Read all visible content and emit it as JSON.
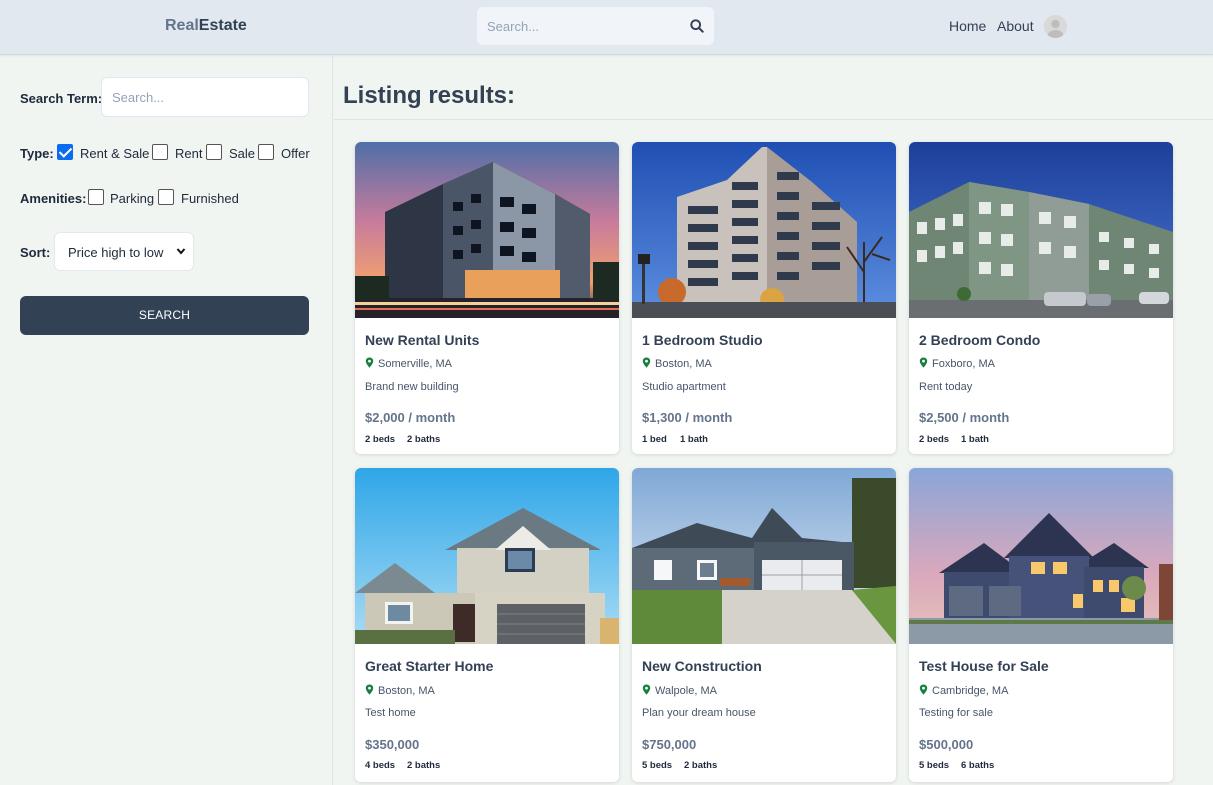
{
  "header": {
    "logo_part1": "Real",
    "logo_part2": "Estate",
    "search_placeholder": "Search...",
    "nav": {
      "home": "Home",
      "about": "About"
    }
  },
  "sidebar": {
    "search_term_label": "Search Term:",
    "search_placeholder": "Search...",
    "type_label": "Type:",
    "types": [
      {
        "label": "Rent & Sale",
        "checked": true
      },
      {
        "label": "Rent",
        "checked": false
      },
      {
        "label": "Sale",
        "checked": false
      },
      {
        "label": "Offer",
        "checked": false
      }
    ],
    "amenities_label": "Amenities:",
    "amenities": [
      {
        "label": "Parking",
        "checked": false
      },
      {
        "label": "Furnished",
        "checked": false
      }
    ],
    "sort_label": "Sort:",
    "sort_value": "Price high to low",
    "search_button": "SEARCH"
  },
  "main": {
    "title": "Listing results:",
    "listings": [
      {
        "title": "New Rental Units",
        "location": "Somerville, MA",
        "description": "Brand new building",
        "price": "$2,000 / month",
        "beds": "2 beds",
        "baths": "2 baths"
      },
      {
        "title": "1 Bedroom Studio",
        "location": "Boston, MA",
        "description": "Studio apartment",
        "price": "$1,300 / month",
        "beds": "1 bed",
        "baths": "1 bath"
      },
      {
        "title": "2 Bedroom Condo",
        "location": "Foxboro, MA",
        "description": "Rent today",
        "price": "$2,500 / month",
        "beds": "2 beds",
        "baths": "1 bath"
      },
      {
        "title": "Great Starter Home",
        "location": "Boston, MA",
        "description": "Test home",
        "price": "$350,000",
        "beds": "4 beds",
        "baths": "2 baths"
      },
      {
        "title": "New Construction",
        "location": "Walpole, MA",
        "description": "Plan your dream house",
        "price": "$750,000",
        "beds": "5 beds",
        "baths": "2 baths"
      },
      {
        "title": "Test House for Sale",
        "location": "Cambridge, MA",
        "description": "Testing for sale",
        "price": "$500,000",
        "beds": "5 beds",
        "baths": "6 baths"
      }
    ]
  },
  "colors": {
    "header_bg": "#e2e8f0",
    "page_bg": "#f1f5f1",
    "button_bg": "#334155",
    "checkbox_checked": "#0a6cf0",
    "pin_green": "#15803d"
  },
  "icons": {
    "header_search": "search-icon",
    "avatar": "avatar-icon",
    "sort_dropdown": "chevron-down-icon",
    "location": "map-pin-icon"
  }
}
